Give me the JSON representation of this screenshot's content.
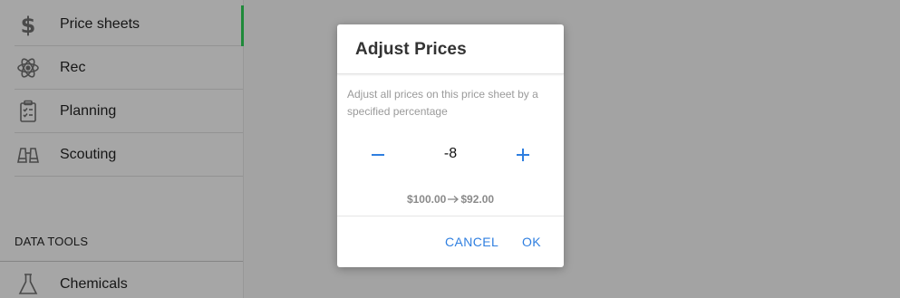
{
  "sidebar": {
    "items": [
      {
        "label": "Price sheets",
        "icon": "dollar-icon"
      },
      {
        "label": "Rec",
        "icon": "atom-icon"
      },
      {
        "label": "Planning",
        "icon": "clipboard-icon"
      },
      {
        "label": "Scouting",
        "icon": "binoculars-icon"
      }
    ],
    "section_label": "DATA TOOLS",
    "section_items": [
      {
        "label": "Chemicals",
        "icon": "flask-icon"
      }
    ]
  },
  "dialog": {
    "title": "Adjust Prices",
    "description": "Adjust all prices on this price sheet by a specified percentage",
    "stepper": {
      "value": "-8",
      "decrement_icon": "minus-icon",
      "increment_icon": "plus-icon"
    },
    "price_change": {
      "from": "$100.00",
      "to": "$92.00",
      "arrow_icon": "arrow-right-icon"
    },
    "cancel_label": "CANCEL",
    "ok_label": "OK"
  },
  "colors": {
    "accent": "#2f7fe0",
    "active_indicator": "#1f8a3a",
    "overlay": "#a3a3a3"
  }
}
